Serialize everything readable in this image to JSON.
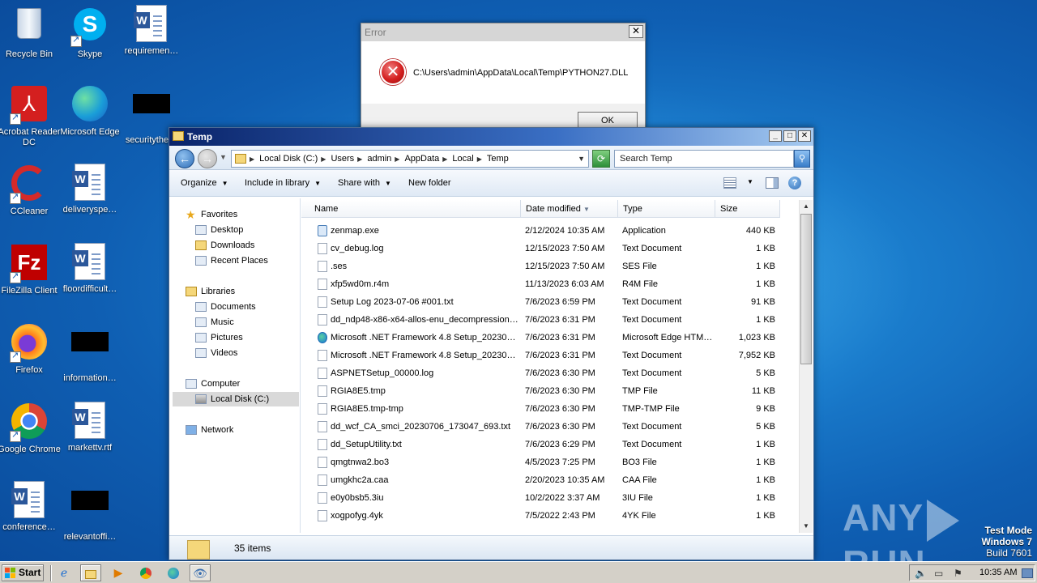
{
  "desktop": {
    "icons": [
      {
        "label": "Recycle Bin",
        "icon": "recycle-bin-icon"
      },
      {
        "label": "Skype",
        "icon": "skype-icon"
      },
      {
        "label": "requiremen…",
        "icon": "word-document-icon"
      },
      {
        "label": "Acrobat Reader DC",
        "icon": "acrobat-icon"
      },
      {
        "label": "Microsoft Edge",
        "icon": "edge-icon"
      },
      {
        "label": "securitythe…",
        "icon": "blacked-out-file-icon"
      },
      {
        "label": "CCleaner",
        "icon": "ccleaner-icon"
      },
      {
        "label": "deliveryspe…",
        "icon": "word-document-icon"
      },
      {
        "label": "FileZilla Client",
        "icon": "filezilla-icon"
      },
      {
        "label": "floordifficult…",
        "icon": "word-document-icon"
      },
      {
        "label": "Firefox",
        "icon": "firefox-icon"
      },
      {
        "label": "information…",
        "icon": "blacked-out-file-icon"
      },
      {
        "label": "Google Chrome",
        "icon": "chrome-icon"
      },
      {
        "label": "markettv.rtf",
        "icon": "word-document-icon"
      },
      {
        "label": "conference…",
        "icon": "word-document-icon"
      },
      {
        "label": "relevantoffi…",
        "icon": "blacked-out-file-icon"
      }
    ]
  },
  "error_dialog": {
    "title": "Error",
    "close_label": "✕",
    "message": "C:\\Users\\admin\\AppData\\Local\\Temp\\PYTHON27.DLL",
    "ok_label": "OK"
  },
  "explorer": {
    "title": "Temp",
    "breadcrumbs": [
      "Local Disk (C:)",
      "Users",
      "admin",
      "AppData",
      "Local",
      "Temp"
    ],
    "search_placeholder": "Search Temp",
    "toolbar": {
      "organize": "Organize",
      "include": "Include in library",
      "share": "Share with",
      "new_folder": "New folder"
    },
    "nav": {
      "favorites": "Favorites",
      "desktop": "Desktop",
      "downloads": "Downloads",
      "recent": "Recent Places",
      "libraries": "Libraries",
      "documents": "Documents",
      "music": "Music",
      "pictures": "Pictures",
      "videos": "Videos",
      "computer": "Computer",
      "local_disk": "Local Disk (C:)",
      "network": "Network"
    },
    "columns": {
      "name": "Name",
      "date": "Date modified",
      "type": "Type",
      "size": "Size"
    },
    "files": [
      {
        "name": "zenmap.exe",
        "date": "2/12/2024 10:35 AM",
        "type": "Application",
        "size": "440 KB",
        "kind": "app"
      },
      {
        "name": "cv_debug.log",
        "date": "12/15/2023 7:50 AM",
        "type": "Text Document",
        "size": "1 KB",
        "kind": "doc"
      },
      {
        "name": ".ses",
        "date": "12/15/2023 7:50 AM",
        "type": "SES File",
        "size": "1 KB",
        "kind": "doc"
      },
      {
        "name": "xfp5wd0m.r4m",
        "date": "11/13/2023 6:03 AM",
        "type": "R4M File",
        "size": "1 KB",
        "kind": "doc"
      },
      {
        "name": "Setup Log 2023-07-06 #001.txt",
        "date": "7/6/2023 6:59 PM",
        "type": "Text Document",
        "size": "91 KB",
        "kind": "doc"
      },
      {
        "name": "dd_ndp48-x86-x64-allos-enu_decompression…",
        "date": "7/6/2023 6:31 PM",
        "type": "Text Document",
        "size": "1 KB",
        "kind": "doc"
      },
      {
        "name": "Microsoft .NET Framework 4.8 Setup_20230…",
        "date": "7/6/2023 6:31 PM",
        "type": "Microsoft Edge HTM…",
        "size": "1,023 KB",
        "kind": "edge"
      },
      {
        "name": "Microsoft .NET Framework 4.8 Setup_20230…",
        "date": "7/6/2023 6:31 PM",
        "type": "Text Document",
        "size": "7,952 KB",
        "kind": "doc"
      },
      {
        "name": "ASPNETSetup_00000.log",
        "date": "7/6/2023 6:30 PM",
        "type": "Text Document",
        "size": "5 KB",
        "kind": "doc"
      },
      {
        "name": "RGIA8E5.tmp",
        "date": "7/6/2023 6:30 PM",
        "type": "TMP File",
        "size": "11 KB",
        "kind": "doc"
      },
      {
        "name": "RGIA8E5.tmp-tmp",
        "date": "7/6/2023 6:30 PM",
        "type": "TMP-TMP File",
        "size": "9 KB",
        "kind": "doc"
      },
      {
        "name": "dd_wcf_CA_smci_20230706_173047_693.txt",
        "date": "7/6/2023 6:30 PM",
        "type": "Text Document",
        "size": "5 KB",
        "kind": "doc"
      },
      {
        "name": "dd_SetupUtility.txt",
        "date": "7/6/2023 6:29 PM",
        "type": "Text Document",
        "size": "1 KB",
        "kind": "doc"
      },
      {
        "name": "qmgtnwa2.bo3",
        "date": "4/5/2023 7:25 PM",
        "type": "BO3 File",
        "size": "1 KB",
        "kind": "doc"
      },
      {
        "name": "umgkhc2a.caa",
        "date": "2/20/2023 10:35 AM",
        "type": "CAA File",
        "size": "1 KB",
        "kind": "doc"
      },
      {
        "name": "e0y0bsb5.3iu",
        "date": "10/2/2022 3:37 AM",
        "type": "3IU File",
        "size": "1 KB",
        "kind": "doc"
      },
      {
        "name": "xogpofyg.4yk",
        "date": "7/5/2022 2:43 PM",
        "type": "4YK File",
        "size": "1 KB",
        "kind": "doc"
      }
    ],
    "status_text": "35 items"
  },
  "taskbar": {
    "start_label": "Start",
    "clock": "10:35 AM"
  },
  "watermark": {
    "left": "ANY",
    "right": "RUN"
  },
  "os_info": {
    "line1": "Test Mode",
    "line2": "Windows 7",
    "line3": "Build 7601"
  }
}
